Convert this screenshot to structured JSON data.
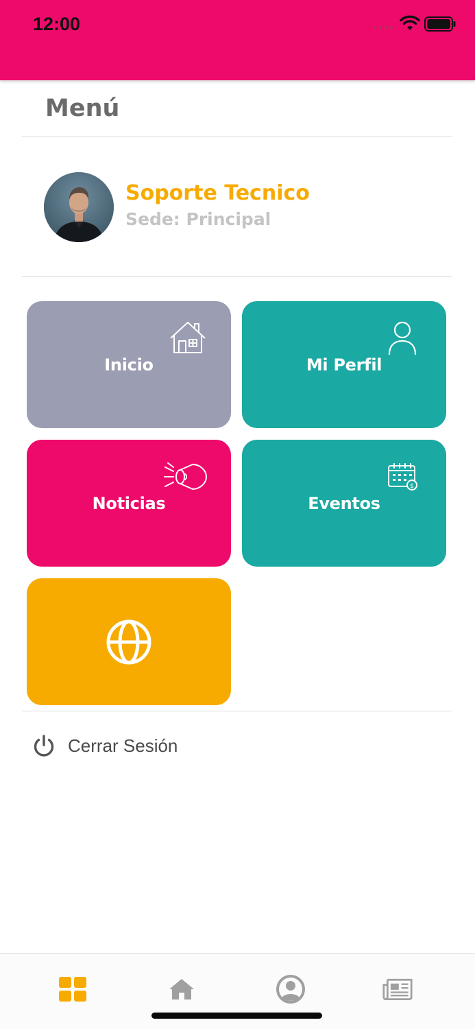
{
  "status_bar": {
    "time": "12:00",
    "background": "#ee0a6b",
    "icons": [
      "signal-icon",
      "wifi-icon",
      "battery-icon"
    ]
  },
  "menu": {
    "title": "Menú"
  },
  "profile": {
    "name": "Soporte Tecnico",
    "sede": "Sede: Principal",
    "name_color": "#f7ab00"
  },
  "tiles": [
    {
      "label": "Inicio",
      "icon": "house-icon",
      "color": "#9b9db2"
    },
    {
      "label": "Mi Perfil",
      "icon": "user-icon",
      "color": "#1aa9a3"
    },
    {
      "label": "Noticias",
      "icon": "megaphone-icon",
      "color": "#ee0a6b"
    },
    {
      "label": "Eventos",
      "icon": "calendar-icon",
      "color": "#1aa9a3"
    },
    {
      "label": "",
      "icon": "globe-icon",
      "color": "#f7ab00"
    }
  ],
  "logout": {
    "label": "Cerrar Sesión",
    "icon": "power-icon"
  },
  "tab_bar": {
    "tabs": [
      {
        "icon": "grid-icon",
        "active": true,
        "color": "#f7ab00"
      },
      {
        "icon": "home-icon",
        "active": false,
        "color": "#a0a0a0"
      },
      {
        "icon": "user-circle-icon",
        "active": false,
        "color": "#a0a0a0"
      },
      {
        "icon": "newspaper-icon",
        "active": false,
        "color": "#a0a0a0"
      }
    ]
  }
}
